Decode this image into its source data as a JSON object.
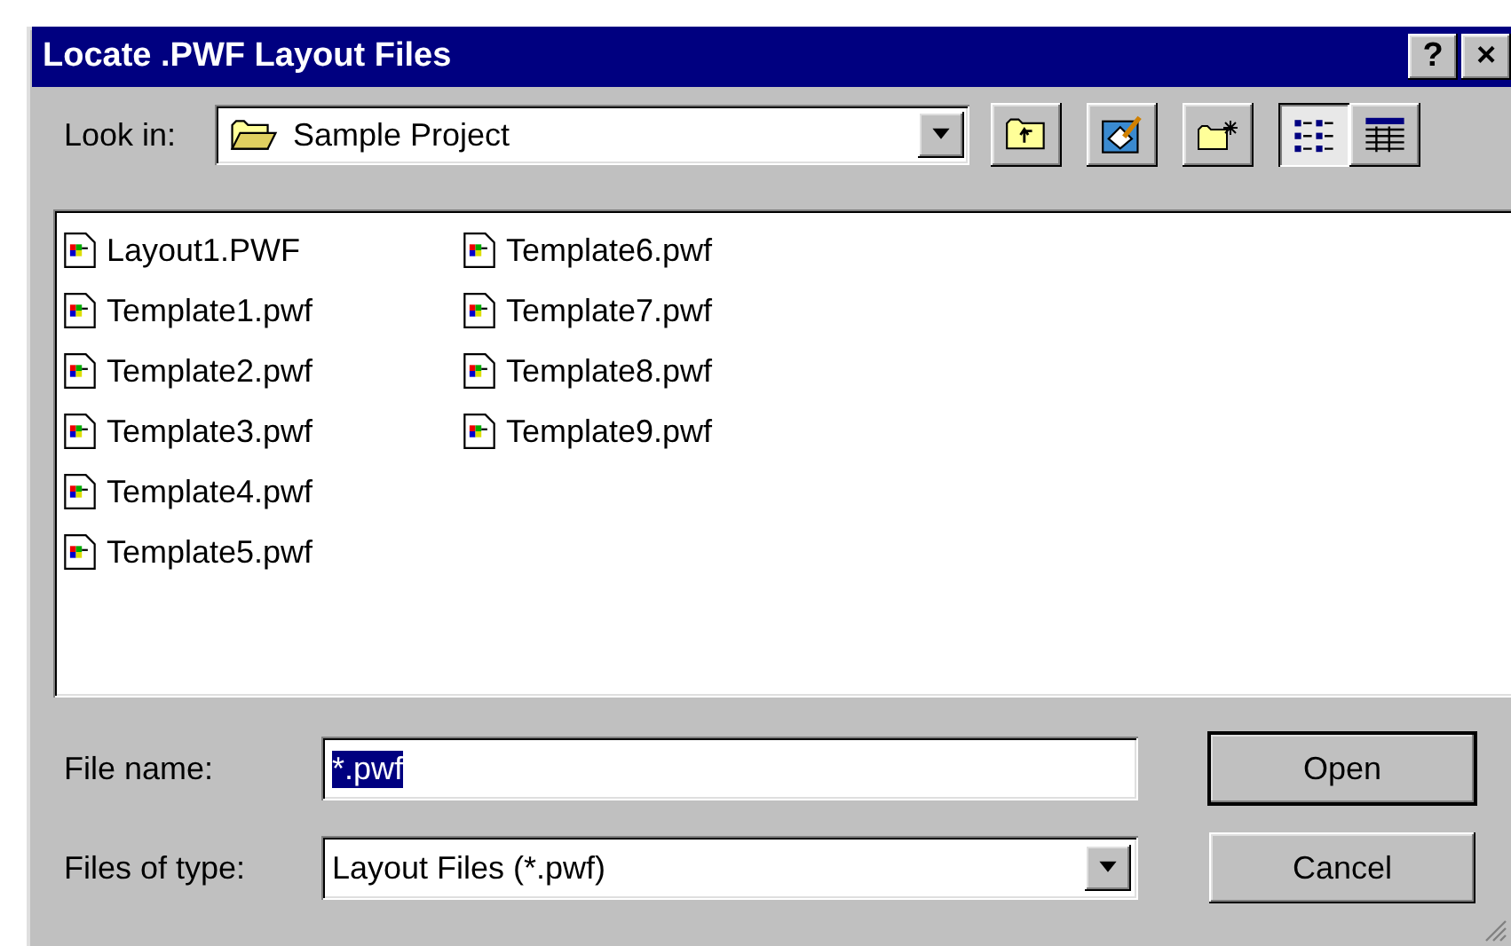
{
  "window": {
    "title": "Locate .PWF Layout Files",
    "title_buttons": [
      "?",
      "×"
    ]
  },
  "look_in": {
    "label": "Look in:",
    "value": "Sample Project"
  },
  "toolbar": [
    {
      "kind": "up-folder",
      "selected": false
    },
    {
      "kind": "desktop",
      "selected": false
    },
    {
      "kind": "new-folder",
      "selected": false
    },
    {
      "kind": "list-view",
      "selected": true
    },
    {
      "kind": "details-view",
      "selected": false
    }
  ],
  "files": [
    {
      "name": "Layout1.PWF"
    },
    {
      "name": "Template1.pwf"
    },
    {
      "name": "Template2.pwf"
    },
    {
      "name": "Template3.pwf"
    },
    {
      "name": "Template4.pwf"
    },
    {
      "name": "Template5.pwf"
    },
    {
      "name": "Template6.pwf"
    },
    {
      "name": "Template7.pwf"
    },
    {
      "name": "Template8.pwf"
    },
    {
      "name": "Template9.pwf"
    }
  ],
  "file_name": {
    "label": "File name:",
    "value": "*.pwf",
    "text_selected": true
  },
  "file_type": {
    "label": "Files of type:",
    "value": "Layout Files (*.pwf)"
  },
  "buttons": [
    {
      "label": "Open",
      "default": true
    },
    {
      "label": "Cancel",
      "default": false
    }
  ]
}
